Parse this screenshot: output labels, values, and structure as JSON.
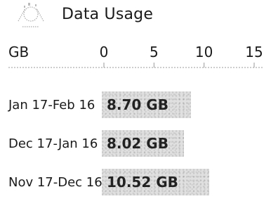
{
  "header": {
    "title": "Data Usage",
    "icon": "data-usage-icon"
  },
  "chart_data": {
    "type": "bar",
    "orientation": "horizontal",
    "title": "",
    "unit_label": "GB",
    "xlim": [
      0,
      15
    ],
    "ticks": [
      "0",
      "5",
      "10",
      "15"
    ],
    "tick_values": [
      0,
      5,
      10,
      15
    ],
    "categories": [
      "Jan 17-Feb 16",
      "Dec 17-Jan 16",
      "Nov 17-Dec 16"
    ],
    "values": [
      8.7,
      8.02,
      10.52
    ],
    "value_labels": [
      "8.70 GB",
      "8.02 GB",
      "10.52 GB"
    ],
    "bar_color": "#e0e0e0"
  }
}
